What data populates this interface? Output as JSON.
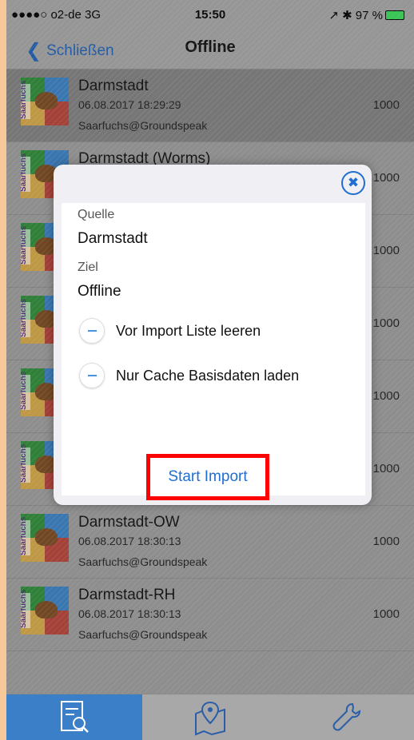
{
  "status_bar": {
    "carrier": "●●●●○ o2-de  3G",
    "time": "15:50",
    "battery": "↗ ✱ 97 %"
  },
  "nav": {
    "back_label": "Schließen",
    "title": "Offline"
  },
  "list": [
    {
      "name": "Darmstadt",
      "date": "06.08.2017 18:29:29",
      "owner": "Saarfuchs@Groundspeak",
      "count": "1000"
    },
    {
      "name": "Darmstadt (Worms)",
      "date": "",
      "owner": "",
      "count": "1000"
    },
    {
      "name": "",
      "date": "",
      "owner": "",
      "count": "1000"
    },
    {
      "name": "",
      "date": "",
      "owner": "",
      "count": "1000"
    },
    {
      "name": "",
      "date": "",
      "owner": "",
      "count": "1000"
    },
    {
      "name": "",
      "date": "",
      "owner": "",
      "count": "1000"
    },
    {
      "name": "Darmstadt-OW",
      "date": "06.08.2017 18:30:13",
      "owner": "Saarfuchs@Groundspeak",
      "count": "1000"
    },
    {
      "name": "Darmstadt-RH",
      "date": "06.08.2017 18:30:13",
      "owner": "Saarfuchs@Groundspeak",
      "count": "1000"
    }
  ],
  "thumb_brand": "Saarfuchs",
  "modal": {
    "source_label": "Quelle",
    "source_value": "Darmstadt",
    "target_label": "Ziel",
    "target_value": "Offline",
    "option1": "Vor Import Liste leeren",
    "option2": "Nur Cache Basisdaten laden",
    "start_label": "Start Import"
  },
  "tabs": [
    {
      "icon": "list-search-icon",
      "active": true
    },
    {
      "icon": "map-pin-icon",
      "active": false
    },
    {
      "icon": "wrench-icon",
      "active": false
    }
  ],
  "colors": {
    "accent": "#1f6fd0",
    "highlight_border": "#ff0000",
    "tab_active": "#3b7fc9"
  }
}
